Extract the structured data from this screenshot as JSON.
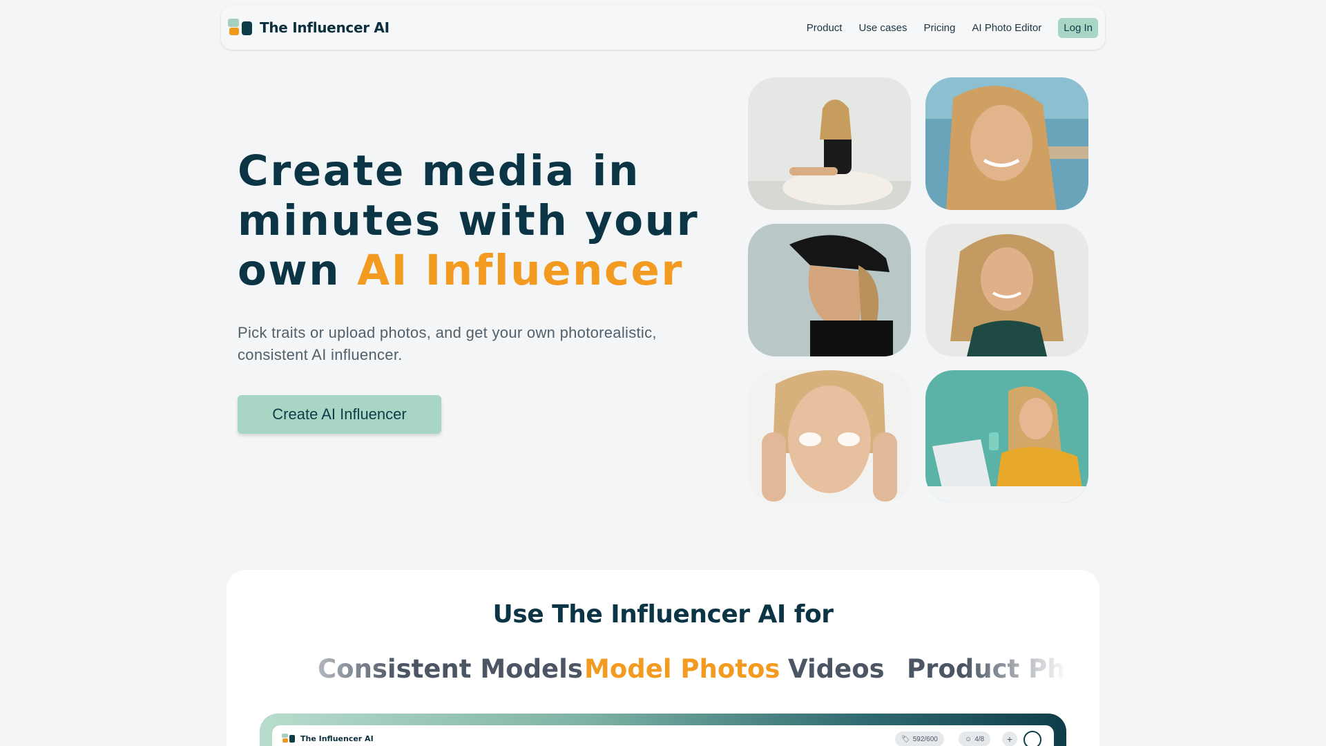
{
  "nav": {
    "brand": "The Influencer AI",
    "links": [
      "Product",
      "Use cases",
      "Pricing",
      "AI Photo Editor"
    ],
    "login": "Log In"
  },
  "hero": {
    "title_part1": "Create media in minutes with your own ",
    "title_accent": "AI Influencer",
    "subtitle": "Pick traits or upload photos, and get your own photorealistic, consistent AI influencer.",
    "cta": "Create AI Influencer"
  },
  "gallery": {
    "icons": [
      "photo-sitting-ballet",
      "photo-smiling-sea",
      "photo-profile-cap",
      "photo-smiling-tank-top",
      "photo-eye-patches",
      "photo-phone-laptop"
    ]
  },
  "usecases": {
    "title": "Use The Influencer AI for",
    "items": [
      "Consistent Models",
      "Model Photos",
      "Videos",
      "Product Photos"
    ],
    "active_index": 1
  },
  "preview": {
    "brand": "The Influencer AI",
    "credits": "592/600",
    "models": "4/8",
    "plus": "+"
  },
  "colors": {
    "primary": "#0b3445",
    "accent": "#f39a21",
    "mint": "#a9d6c4",
    "background": "#f3f5f7"
  }
}
